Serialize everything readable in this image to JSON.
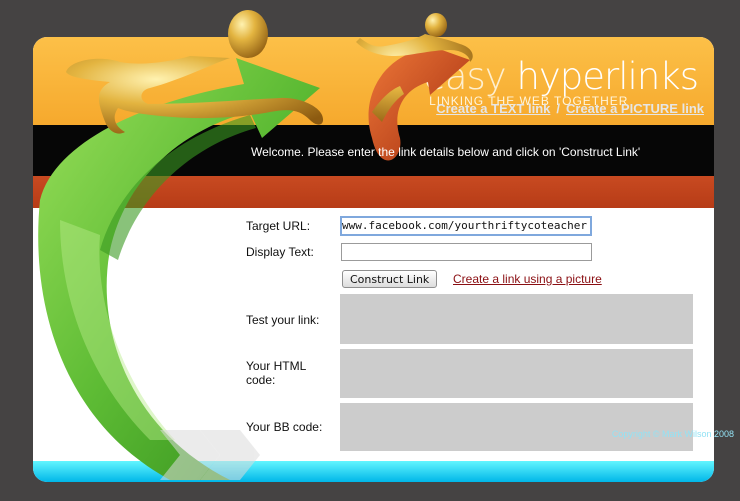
{
  "brand": {
    "name_part1": "easy",
    "name_part2": " hyperlinks",
    "tagline": "LINKING THE WEB TOGETHER"
  },
  "nav": {
    "text_link": "Create a TEXT link",
    "separator": "/",
    "picture_link": "Create a PICTURE link"
  },
  "welcome": "Welcome. Please enter the link details below and click on 'Construct Link'",
  "form": {
    "target_url_label": "Target URL:",
    "target_url_value": "https://www.facebook.com/yourthriftycoteacher",
    "display_text_label": "Display Text:",
    "display_text_value": "",
    "construct_button": "Construct Link",
    "create_picture_link": "Create a link using a picture",
    "test_label": "Test your link:",
    "html_label_line1": "Your HTML",
    "html_label_line2": "code:",
    "bb_label": "Your BB code:"
  },
  "footer": {
    "copyright": "Copyright © Mark Wilson 2008"
  },
  "colors": {
    "background": "#454343",
    "orange": "#f6a92d",
    "black_band": "#060606",
    "red_band": "#b73c17",
    "cyan_footer": "#00b6e8",
    "green_arrow": "#5dbb34",
    "red_arrow": "#c9421a",
    "gold_figure": "#d9a43a",
    "output_box": "#cccccc",
    "link_red": "#8a0e12"
  },
  "icons": {
    "illustration": "gold-figures-riding-arrows"
  }
}
